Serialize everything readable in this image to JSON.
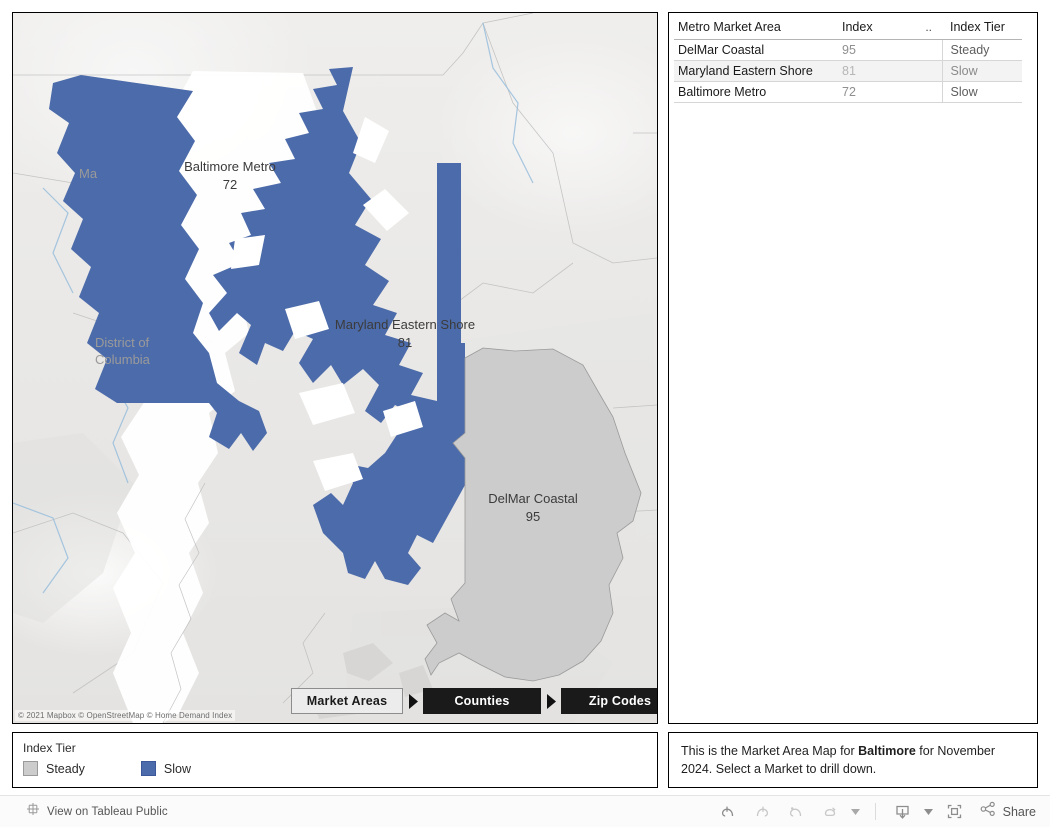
{
  "map": {
    "attribution": "© 2021 Mapbox © OpenStreetMap © Home Demand Index",
    "region_labels": [
      {
        "name": "Baltimore Metro",
        "value": "72",
        "tier": "Slow"
      },
      {
        "name": "Maryland Eastern Shore",
        "value": "81",
        "tier": "Slow"
      },
      {
        "name": "DelMar Coastal",
        "value": "95",
        "tier": "Steady"
      }
    ],
    "basemap_labels": [
      {
        "text": "Ma"
      },
      {
        "text": "District of"
      },
      {
        "text": "Columbia"
      }
    ]
  },
  "breadcrumb": {
    "items": [
      {
        "label": "Market Areas",
        "state": "active"
      },
      {
        "label": "Counties",
        "state": "inactive"
      },
      {
        "label": "Zip Codes",
        "state": "inactive"
      }
    ]
  },
  "legend": {
    "title": "Index Tier",
    "items": [
      {
        "label": "Steady",
        "color": "#cccccc"
      },
      {
        "label": "Slow",
        "color": "#4c6baa"
      }
    ]
  },
  "table": {
    "columns": [
      "Metro Market Area",
      "Index",
      "..",
      "Index Tier"
    ],
    "rows": [
      {
        "area": "DelMar Coastal",
        "index": "95",
        "tier": "Steady"
      },
      {
        "area": "Maryland Eastern Shore",
        "index": "81",
        "tier": "Slow"
      },
      {
        "area": "Baltimore Metro",
        "index": "72",
        "tier": "Slow"
      }
    ]
  },
  "description": {
    "prefix": "This is the Market Area Map for ",
    "bold": "Baltimore",
    "suffix": " for November 2024.  Select a Market to drill down."
  },
  "toolbar": {
    "view_label": "View on Tableau Public",
    "share_label": "Share",
    "buttons": [
      "undo",
      "redo",
      "revert",
      "refresh",
      "pause-dropdown",
      "download",
      "fullscreen",
      "share"
    ]
  },
  "colors": {
    "slow": "#4c6baa",
    "steady": "#cccccc",
    "map_land": "#eae9e7",
    "map_water": "#ffffff",
    "accent_dark": "#1a1a1a"
  }
}
